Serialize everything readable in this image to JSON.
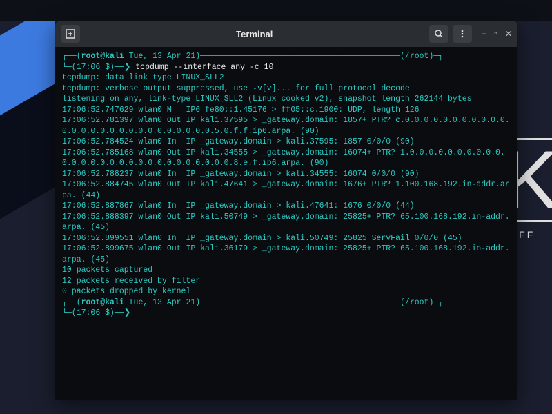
{
  "titlebar": {
    "title": "Terminal"
  },
  "kali_branding": {
    "letter": "K",
    "subtitle": "BY OFF"
  },
  "prompt1": {
    "user_host": "root@kali",
    "date": "Tue, 13 Apr 21",
    "path": "/root",
    "time": "17:06 $",
    "command": "tcpdump --interface any -c 10"
  },
  "output": [
    "tcpdump: data link type LINUX_SLL2",
    "tcpdump: verbose output suppressed, use -v[v]... for full protocol decode",
    "listening on any, link-type LINUX_SLL2 (Linux cooked v2), snapshot length 262144 bytes",
    "17:06:52.747629 wlan0 M   IP6 fe80::1.45176 > ff05::c.1900: UDP, length 126",
    "17:06:52.781397 wlan0 Out IP kali.37595 > _gateway.domain: 1857+ PTR? c.0.0.0.0.0.0.0.0.0.0.0.0.0.0.0.0.0.0.0.0.0.0.0.0.0.0.0.5.0.f.f.ip6.arpa. (90)",
    "17:06:52.784524 wlan0 In  IP _gateway.domain > kali.37595: 1857 0/0/0 (90)",
    "17:06:52.785168 wlan0 Out IP kali.34555 > _gateway.domain: 16074+ PTR? 1.0.0.0.0.0.0.0.0.0.0.0.0.0.0.0.0.0.0.0.0.0.0.0.0.0.0.0.0.8.e.f.ip6.arpa. (90)",
    "17:06:52.788237 wlan0 In  IP _gateway.domain > kali.34555: 16074 0/0/0 (90)",
    "17:06:52.884745 wlan0 Out IP kali.47641 > _gateway.domain: 1676+ PTR? 1.100.168.192.in-addr.arpa. (44)",
    "17:06:52.887867 wlan0 In  IP _gateway.domain > kali.47641: 1676 0/0/0 (44)",
    "17:06:52.888397 wlan0 Out IP kali.50749 > _gateway.domain: 25825+ PTR? 65.100.168.192.in-addr.arpa. (45)",
    "17:06:52.899551 wlan0 In  IP _gateway.domain > kali.50749: 25825 ServFail 0/0/0 (45)",
    "17:06:52.899675 wlan0 Out IP kali.36179 > _gateway.domain: 25825+ PTR? 65.100.168.192.in-addr.arpa. (45)",
    "10 packets captured",
    "12 packets received by filter",
    "0 packets dropped by kernel"
  ],
  "prompt2": {
    "user_host": "root@kali",
    "date": "Tue, 13 Apr 21",
    "path": "/root",
    "time": "17:06 $"
  }
}
